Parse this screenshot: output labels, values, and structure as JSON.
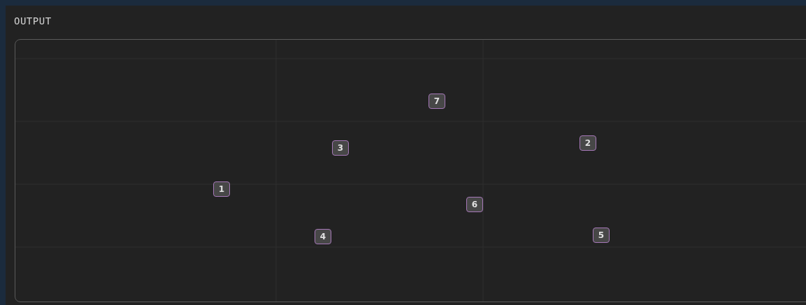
{
  "panel": {
    "title": "OUTPUT"
  },
  "markers": [
    {
      "label": "1"
    },
    {
      "label": "2"
    },
    {
      "label": "3"
    },
    {
      "label": "4"
    },
    {
      "label": "5"
    },
    {
      "label": "6"
    },
    {
      "label": "7"
    }
  ]
}
